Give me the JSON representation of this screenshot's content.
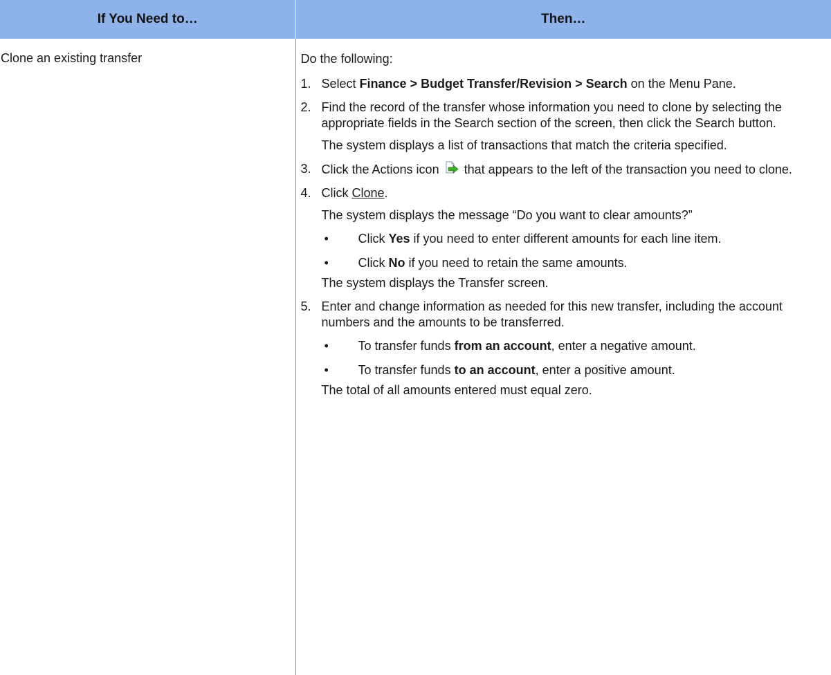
{
  "table": {
    "headers": [
      "If You Need to…",
      "Then…"
    ],
    "row": {
      "condition": "Clone an existing transfer",
      "intro": "Do the following:",
      "steps": [
        {
          "number": "1.",
          "pre": "Select ",
          "bold": "Finance > Budget Transfer/Revision > Search",
          "post": " on the Menu Pane."
        },
        {
          "number": "2.",
          "text": "Find the record of the transfer whose information you need to clone by selecting the appropriate fields in the Search section of the screen, then click the Search button.",
          "result": "The system displays a list of transactions that match the criteria specified."
        },
        {
          "number": "3.",
          "pre": "Click the Actions icon",
          "icon": "actions-icon",
          "post": "that appears to the left of the transaction you need to clone."
        },
        {
          "number": "4.",
          "pre": "Click ",
          "link": "Clone",
          "post": ".",
          "result": "The system displays the message “Do you want to clear amounts?”",
          "bullets": [
            {
              "pre": "Click ",
              "bold": "Yes",
              "post": " if you need to enter different amounts for each line item."
            },
            {
              "pre": "Click ",
              "bold": "No",
              "post": " if you need to retain the same amounts."
            }
          ],
          "result2": "The system displays the Transfer screen."
        },
        {
          "number": "5.",
          "text": "Enter and change information as needed for this new transfer, including the account numbers and the amounts to be transferred.",
          "bullets": [
            {
              "pre": "To transfer funds ",
              "bold": "from an account",
              "post": ", enter a negative amount."
            },
            {
              "pre": "To transfer funds ",
              "bold": "to an account",
              "post": ", enter a positive amount."
            }
          ],
          "result": "The total of all amounts entered must equal zero."
        }
      ]
    }
  },
  "bullet_glyph": "•",
  "colors": {
    "header_bg": "#8db3ea",
    "divider": "#8a8a8a",
    "icon_green": "#3cae2c"
  }
}
